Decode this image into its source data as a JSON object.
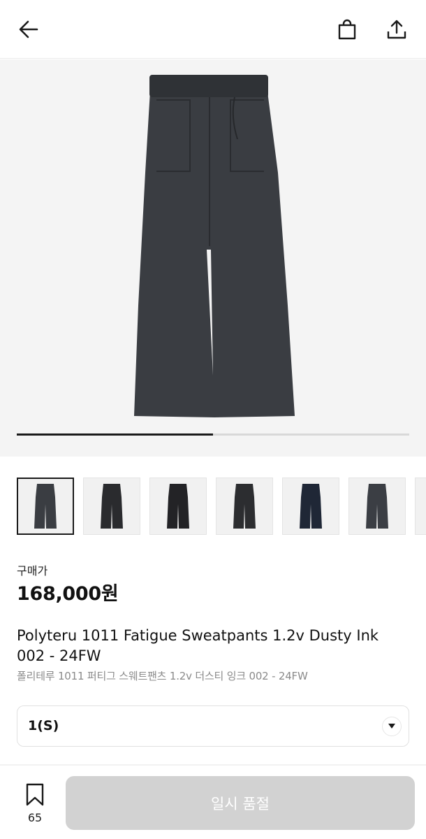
{
  "header": {
    "back_icon": "arrow-left-icon",
    "bag_icon": "shopping-bag-icon",
    "share_icon": "share-icon"
  },
  "gallery": {
    "current_progress": 0.5,
    "main_image_color": "#3a3d42",
    "thumbnails": [
      {
        "color": "#3a3d42",
        "active": true
      },
      {
        "color": "#2a2b2e",
        "active": false
      },
      {
        "color": "#232326",
        "active": false
      },
      {
        "color": "#2c2d30",
        "active": false
      },
      {
        "color": "#1f2736",
        "active": false
      },
      {
        "color": "#3b3e44",
        "active": false
      },
      {
        "color": "#2f3033",
        "active": false
      }
    ]
  },
  "price": {
    "label": "구매가",
    "value": "168,000원"
  },
  "product": {
    "title_en": "Polyteru 1011 Fatigue Sweatpants 1.2v Dusty Ink 002 - 24FW",
    "title_ko": "폴리테루 1011 퍼티그 스웨트팬츠 1.2v 더스티 잉크 002 - 24FW"
  },
  "size_select": {
    "value": "1(S)",
    "icon": "chevron-down-icon"
  },
  "bottom_bar": {
    "wishlist_icon": "bookmark-icon",
    "wishlist_count": "65",
    "buy_button_label": "일시 품절",
    "buy_button_color": "#d2d2d2"
  }
}
